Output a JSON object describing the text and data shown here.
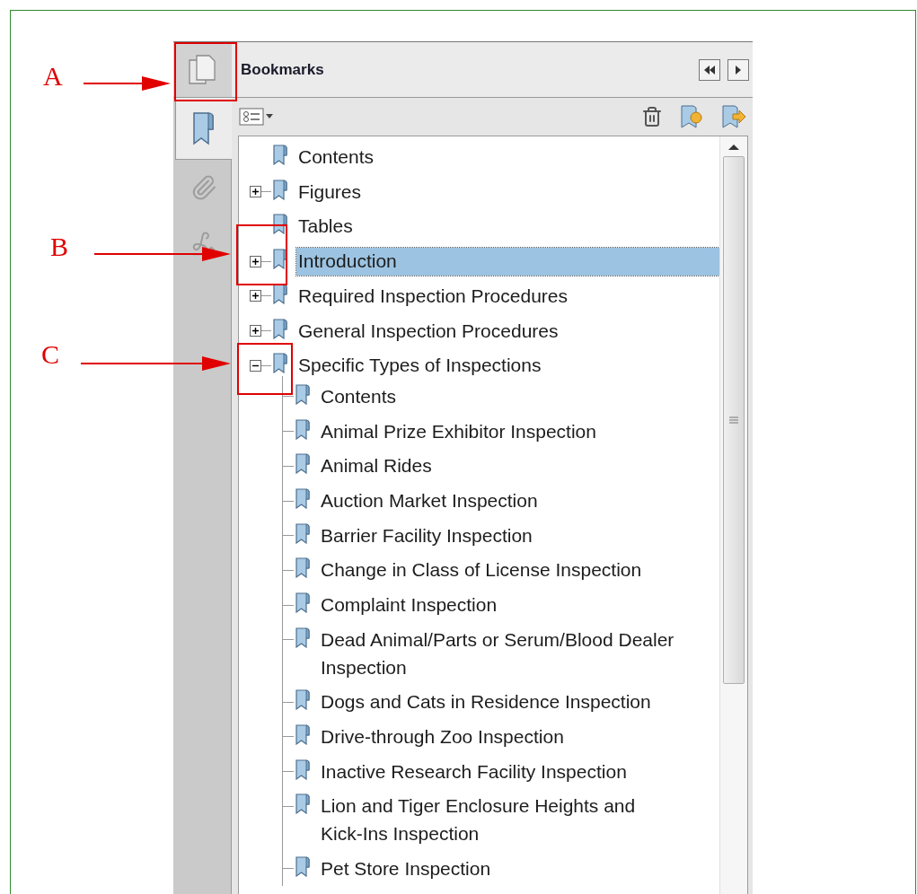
{
  "annotations": [
    {
      "label": "A"
    },
    {
      "label": "B"
    },
    {
      "label": "C"
    }
  ],
  "panel": {
    "title": "Bookmarks",
    "side_tabs": [
      {
        "kind": "bookmarks",
        "selected": true
      },
      {
        "kind": "attachments",
        "selected": false
      },
      {
        "kind": "signatures",
        "selected": false
      }
    ],
    "bookmarks": [
      {
        "label": "Contents",
        "selected": false
      },
      {
        "label": "Figures",
        "selected": false,
        "expanded": false
      },
      {
        "label": "Tables",
        "selected": false
      },
      {
        "label": "Introduction",
        "selected": true,
        "expanded": false
      },
      {
        "label": "Required Inspection Procedures",
        "selected": false,
        "expanded": false
      },
      {
        "label": "General Inspection Procedures",
        "selected": false,
        "expanded": false
      },
      {
        "label": "Specific Types of Inspections",
        "selected": false,
        "expanded": true,
        "children": [
          {
            "label": "Contents",
            "selected": false
          },
          {
            "label": "Animal Prize Exhibitor Inspection",
            "selected": false
          },
          {
            "label": "Animal Rides",
            "selected": false
          },
          {
            "label": "Auction Market Inspection",
            "selected": false
          },
          {
            "label": "Barrier Facility Inspection",
            "selected": false
          },
          {
            "label": "Change in Class of License Inspection",
            "selected": false
          },
          {
            "label": "Complaint Inspection",
            "selected": false
          },
          {
            "label": "Dead Animal/Parts or Serum/Blood Dealer Inspection",
            "selected": false
          },
          {
            "label": "Dogs and Cats in Residence Inspection",
            "selected": false
          },
          {
            "label": "Drive-through Zoo Inspection",
            "selected": false
          },
          {
            "label": "Inactive Research Facility Inspection",
            "selected": false
          },
          {
            "label": "Lion and Tiger Enclosure Heights and Kick-Ins Inspection",
            "selected": false
          },
          {
            "label": "Pet Store Inspection",
            "selected": false
          }
        ]
      }
    ]
  }
}
